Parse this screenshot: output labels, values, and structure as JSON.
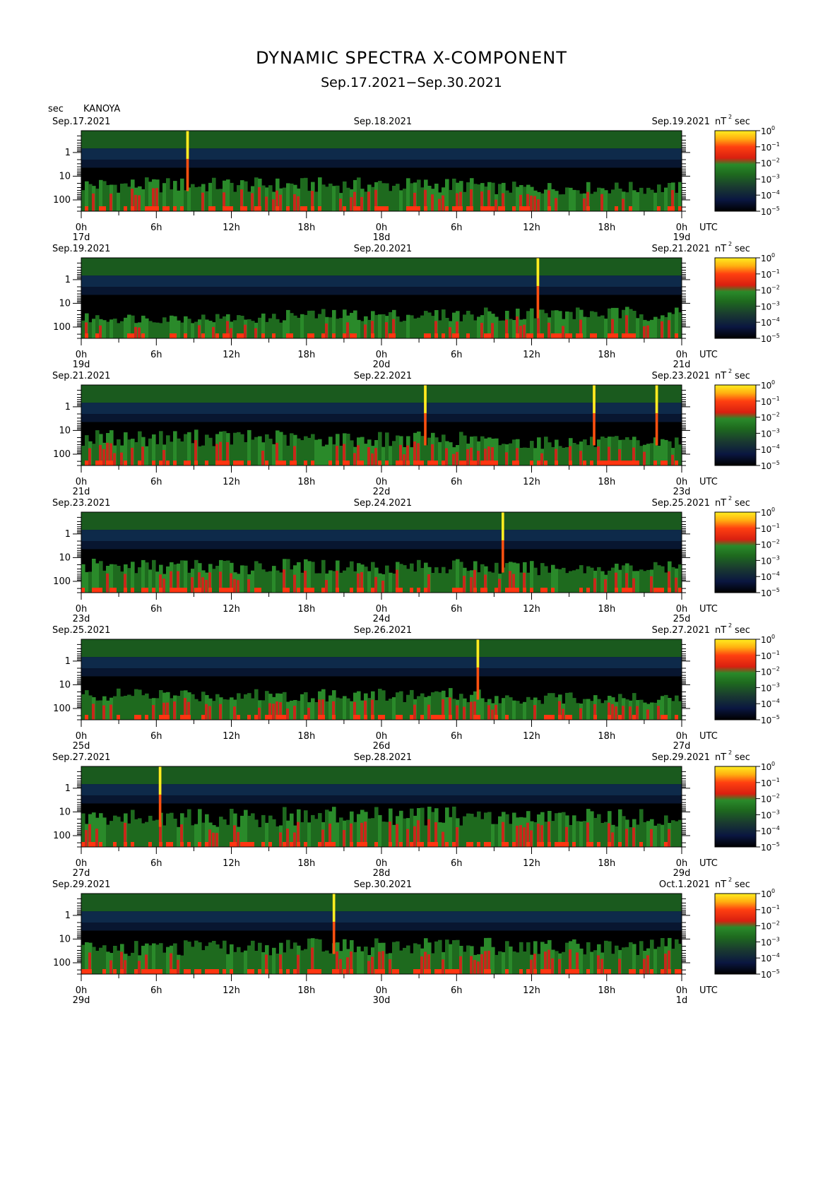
{
  "header": {
    "title": "DYNAMIC SPECTRA X-COMPONENT",
    "subtitle": "Sep.17.2021−Sep.30.2021",
    "yunit": "sec",
    "station": "KANOYA"
  },
  "colors": {
    "scale": [
      "#000000",
      "#0a1640",
      "#1e6a1e",
      "#2a8a2a",
      "#d81f10",
      "#ff4010",
      "#ffee20"
    ],
    "background": "#000000"
  },
  "chart_data": {
    "type": "heatmap",
    "panel_count": 7,
    "x_unit": "UTC",
    "x_tick_labels": [
      "0h",
      "6h",
      "12h",
      "18h",
      "0h",
      "6h",
      "12h",
      "18h",
      "0h"
    ],
    "y_ticks": [
      "1",
      "10",
      "100"
    ],
    "y_tick_values": [
      1,
      10,
      100
    ],
    "ylim": [
      0.12,
      300
    ],
    "y_scale": "log",
    "colorbar": {
      "unit_main": "nT",
      "unit_sup": "2",
      "unit_tail": "sec",
      "tick_bases": [
        "10",
        "10",
        "10",
        "10",
        "10",
        "10"
      ],
      "tick_exps": [
        "0",
        "−1",
        "−2",
        "−3",
        "−4",
        "−5"
      ],
      "range": [
        1e-05,
        1
      ]
    },
    "panels": [
      {
        "left_date": "Sep.17.2021",
        "mid_date": "Sep.18.2021",
        "right_date": "Sep.19.2021",
        "day_labels": [
          "17d",
          "18d",
          "19d"
        ],
        "spikes_hour": [
          8.5
        ],
        "activity": [
          0.55,
          0.55,
          0.45
        ]
      },
      {
        "left_date": "Sep.19.2021",
        "mid_date": "Sep.20.2021",
        "right_date": "Sep.21.2021",
        "day_labels": [
          "19d",
          "20d",
          "21d"
        ],
        "spikes_hour": [
          36.5
        ],
        "activity": [
          0.35,
          0.45,
          0.5
        ]
      },
      {
        "left_date": "Sep.21.2021",
        "mid_date": "Sep.22.2021",
        "right_date": "Sep.23.2021",
        "day_labels": [
          "21d",
          "22d",
          "23d"
        ],
        "spikes_hour": [
          27.5,
          41,
          46
        ],
        "activity": [
          0.6,
          0.55,
          0.45
        ]
      },
      {
        "left_date": "Sep.23.2021",
        "mid_date": "Sep.24.2021",
        "right_date": "Sep.25.2021",
        "day_labels": [
          "23d",
          "24d",
          "25d"
        ],
        "spikes_hour": [
          33.7
        ],
        "activity": [
          0.55,
          0.55,
          0.5
        ]
      },
      {
        "left_date": "Sep.25.2021",
        "mid_date": "Sep.26.2021",
        "right_date": "Sep.27.2021",
        "day_labels": [
          "25d",
          "26d",
          "27d"
        ],
        "spikes_hour": [
          31.7
        ],
        "activity": [
          0.5,
          0.5,
          0.4
        ]
      },
      {
        "left_date": "Sep.27.2021",
        "mid_date": "Sep.28.2021",
        "right_date": "Sep.29.2021",
        "day_labels": [
          "27d",
          "28d",
          "29d"
        ],
        "spikes_hour": [
          6.3
        ],
        "activity": [
          0.65,
          0.7,
          0.65
        ]
      },
      {
        "left_date": "Sep.29.2021",
        "mid_date": "Sep.30.2021",
        "right_date": "Oct.1.2021",
        "day_labels": [
          "29d",
          "30d",
          "1d"
        ],
        "spikes_hour": [
          20.2
        ],
        "activity": [
          0.55,
          0.6,
          0.6
        ]
      }
    ]
  }
}
